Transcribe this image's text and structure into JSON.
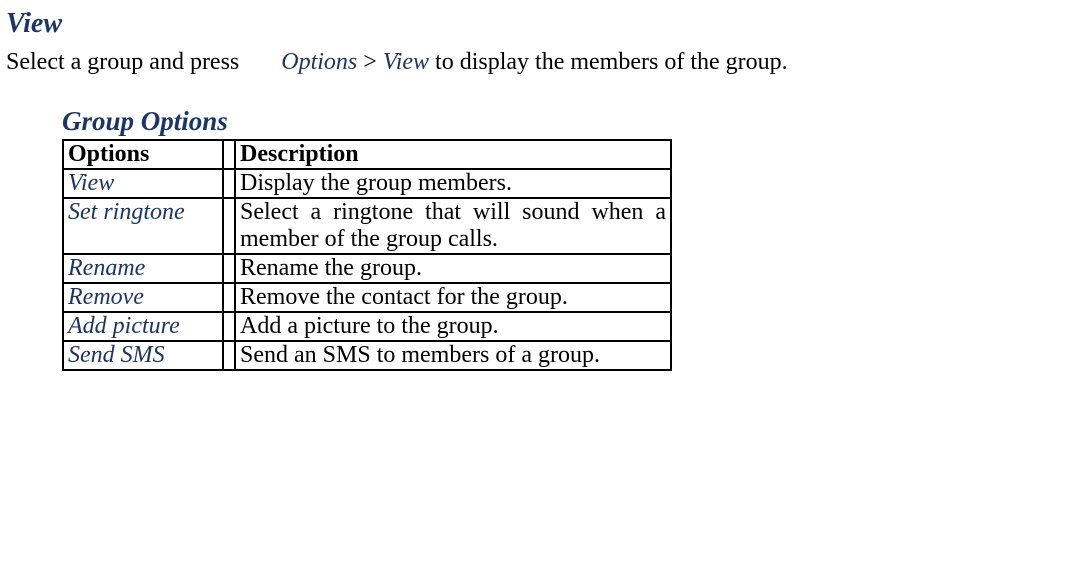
{
  "heading": "View",
  "intro": {
    "prefix": "Select a group and press ",
    "path_options": "Options",
    "path_view": "View",
    "suffix": "to display the members of the group."
  },
  "group_options_heading": "Group Options",
  "table": {
    "headers": {
      "options": "Options",
      "description": "Description"
    },
    "rows": [
      {
        "option": "View",
        "description": "Display the group members."
      },
      {
        "option": "Set ringtone",
        "description": "Select a ringtone that will sound when a member of the group calls."
      },
      {
        "option": "Rename",
        "description": "Rename the group."
      },
      {
        "option": "Remove",
        "description": "Remove the contact for the group."
      },
      {
        "option": "Add picture",
        "description": "Add a picture to the group."
      },
      {
        "option": "Send SMS",
        "description": "Send an SMS to members of a group."
      }
    ]
  }
}
